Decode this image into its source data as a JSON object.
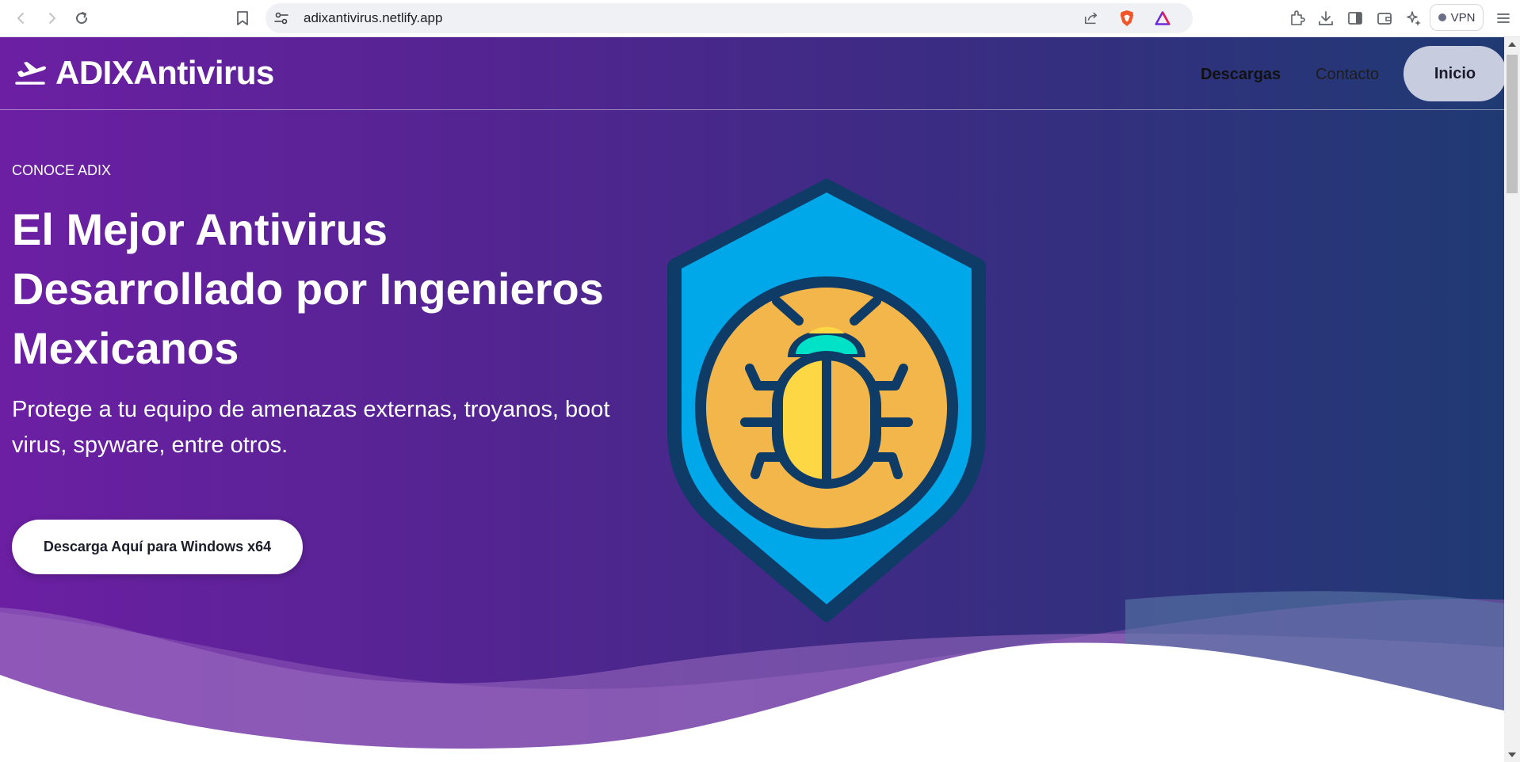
{
  "browser": {
    "url": "adixantivirus.netlify.app",
    "vpn_label": "VPN"
  },
  "site": {
    "logo_text": "ADIXAntivirus",
    "nav": {
      "descargas": "Descargas",
      "contacto": "Contacto",
      "inicio": "Inicio"
    }
  },
  "hero": {
    "eyebrow": "CONOCE ADIX",
    "headline": "El Mejor Antivirus Desarrollado por Ingenieros Mexicanos",
    "subhead": "Protege a tu equipo de amenazas externas, troyanos, boot virus, spyware, entre otros.",
    "cta_label": "Descarga Aquí para Windows x64"
  },
  "colors": {
    "hero_gradient_start": "#6c1fa3",
    "hero_gradient_end": "#1f3a73",
    "shield_blue": "#00a7e9",
    "shield_outline": "#0f3b67",
    "bug_circle": "#f2b64a",
    "bug_body_yellow": "#fdd844",
    "bug_head_teal": "#00e2c8",
    "nav_inicio_bg": "#c7cdde"
  },
  "icons": {
    "logo": "airplane-departure-icon",
    "hero_graphic": "shield-bug-icon"
  }
}
